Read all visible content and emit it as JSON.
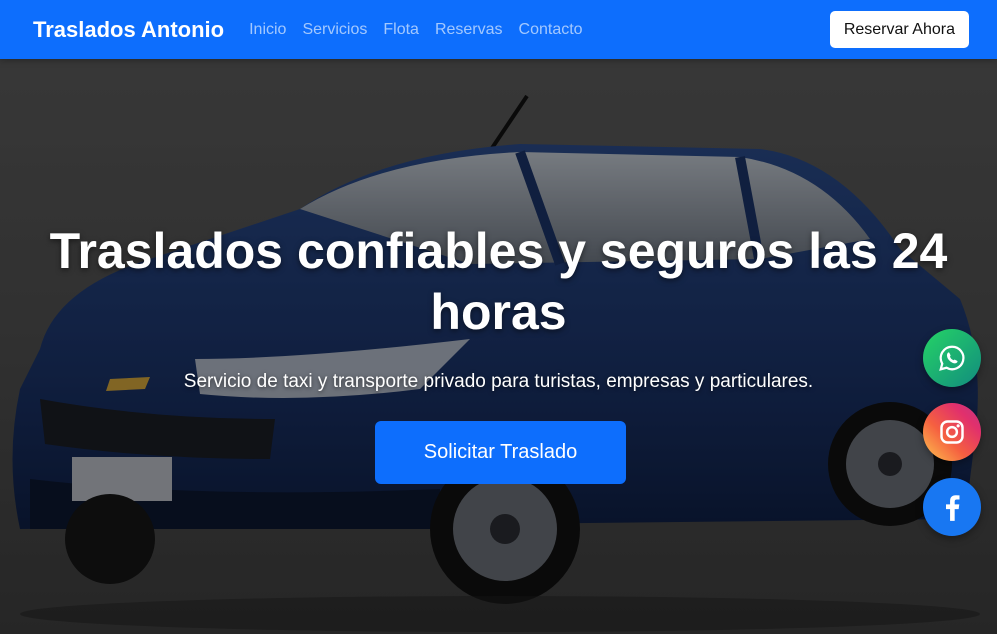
{
  "navbar": {
    "brand": "Traslados Antonio",
    "links": [
      "Inicio",
      "Servicios",
      "Flota",
      "Reservas",
      "Contacto"
    ],
    "cta": "Reservar Ahora"
  },
  "hero": {
    "title": "Traslados confiables y seguros las 24 horas",
    "subtitle": "Servicio de taxi y transporte privado para turistas, empresas y particulares.",
    "button": "Solicitar Traslado"
  },
  "social": [
    "whatsapp-icon",
    "instagram-icon",
    "facebook-icon"
  ],
  "colors": {
    "primary": "#0d6efd",
    "whatsapp": "#25d366",
    "facebook": "#1877f2"
  }
}
